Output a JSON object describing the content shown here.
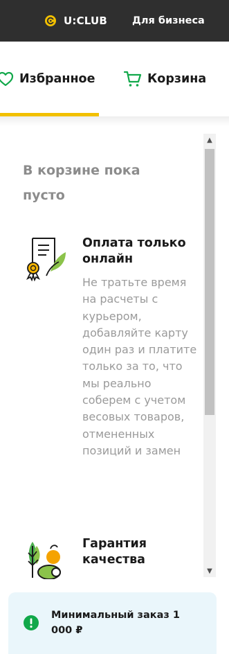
{
  "topbar": {
    "uclub_label": "U:CLUB",
    "business_label": "Для бизнеса",
    "accent_color": "#f2c000"
  },
  "tabs": [
    {
      "label": "Избранное",
      "icon": "heart-icon",
      "active": true
    },
    {
      "label": "Корзина",
      "icon": "cart-icon",
      "active": false
    }
  ],
  "cart": {
    "empty_title": "В корзине пока пусто",
    "features": [
      {
        "icon": "certificate-icon",
        "title": "Оплата только онлайн",
        "description": "Не тратьте время на расчеты с курьером, добавляйте карту один раз и платите только за то, что мы реально соберем с учетом весовых товаров, отмененных позиций и замен"
      },
      {
        "icon": "vegetables-icon",
        "title": "Гарантия качества",
        "description": ""
      }
    ]
  },
  "min_order": {
    "text": "Минимальный заказ 1 000 ₽",
    "icon": "info-icon",
    "icon_color": "#11a84a"
  }
}
